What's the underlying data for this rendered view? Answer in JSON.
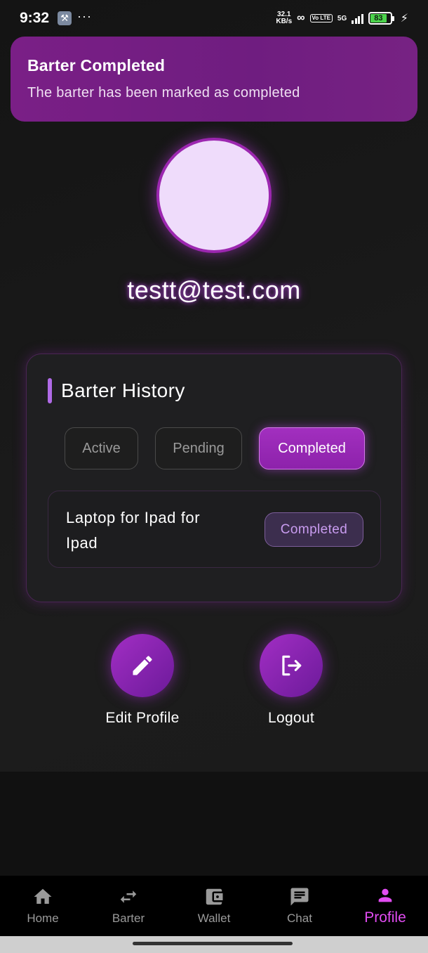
{
  "status_bar": {
    "time": "9:32",
    "speed_value": "32.1",
    "speed_unit": "KB/s",
    "volte": "Vo LTE",
    "network": "5G",
    "battery": "83"
  },
  "toast": {
    "title": "Barter Completed",
    "message": "The barter has been marked as completed"
  },
  "profile": {
    "email": "testt@test.com"
  },
  "history": {
    "title": "Barter History",
    "filters": [
      "Active",
      "Pending",
      "Completed"
    ],
    "selected_filter": "Completed",
    "items": [
      {
        "name": "Laptop for Ipad for Ipad",
        "status": "Completed"
      }
    ]
  },
  "actions": {
    "edit_label": "Edit Profile",
    "logout_label": "Logout"
  },
  "nav": {
    "items": [
      {
        "label": "Home",
        "icon": "home-icon"
      },
      {
        "label": "Barter",
        "icon": "swap-icon"
      },
      {
        "label": "Wallet",
        "icon": "wallet-icon"
      },
      {
        "label": "Chat",
        "icon": "chat-icon"
      },
      {
        "label": "Profile",
        "icon": "person-icon"
      }
    ],
    "active": "Profile"
  },
  "colors": {
    "accent": "#9c27b0",
    "toast_bg": "#7a1f86",
    "active_nav": "#e24cf2"
  }
}
